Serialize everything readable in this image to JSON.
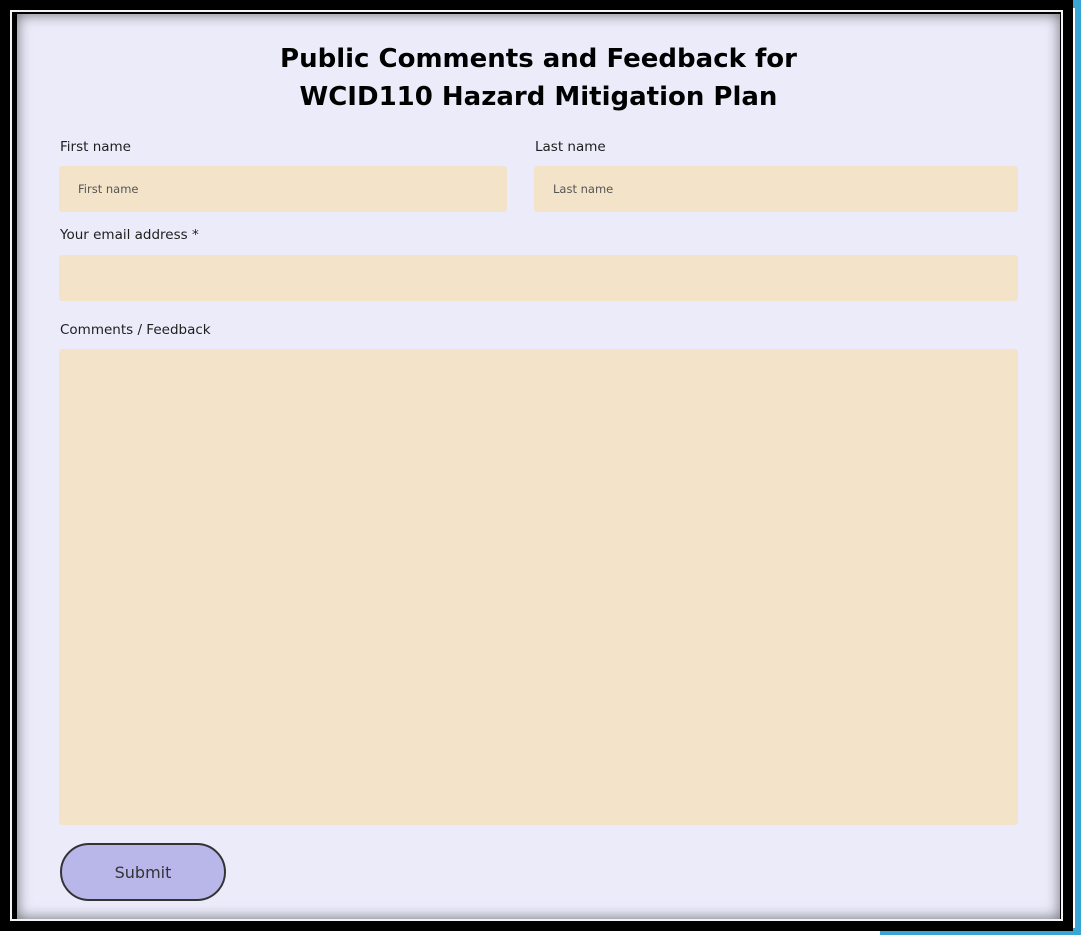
{
  "form": {
    "title_line1": "Public Comments and Feedback for",
    "title_line2": "WCID110 Hazard Mitigation Plan",
    "first_name": {
      "label": "First name",
      "placeholder": "First name",
      "value": ""
    },
    "last_name": {
      "label": "Last name",
      "placeholder": "Last name",
      "value": ""
    },
    "email": {
      "label": "Your email address *",
      "placeholder": "",
      "value": ""
    },
    "comments": {
      "label": "Comments / Feedback",
      "placeholder": "",
      "value": ""
    },
    "submit_label": "Submit"
  },
  "colors": {
    "panel_background": "#ebebfa",
    "field_background": "#f3e4c9",
    "submit_background": "#b9b6ea",
    "frame": "#000000",
    "accent": "#3aa6d6"
  }
}
